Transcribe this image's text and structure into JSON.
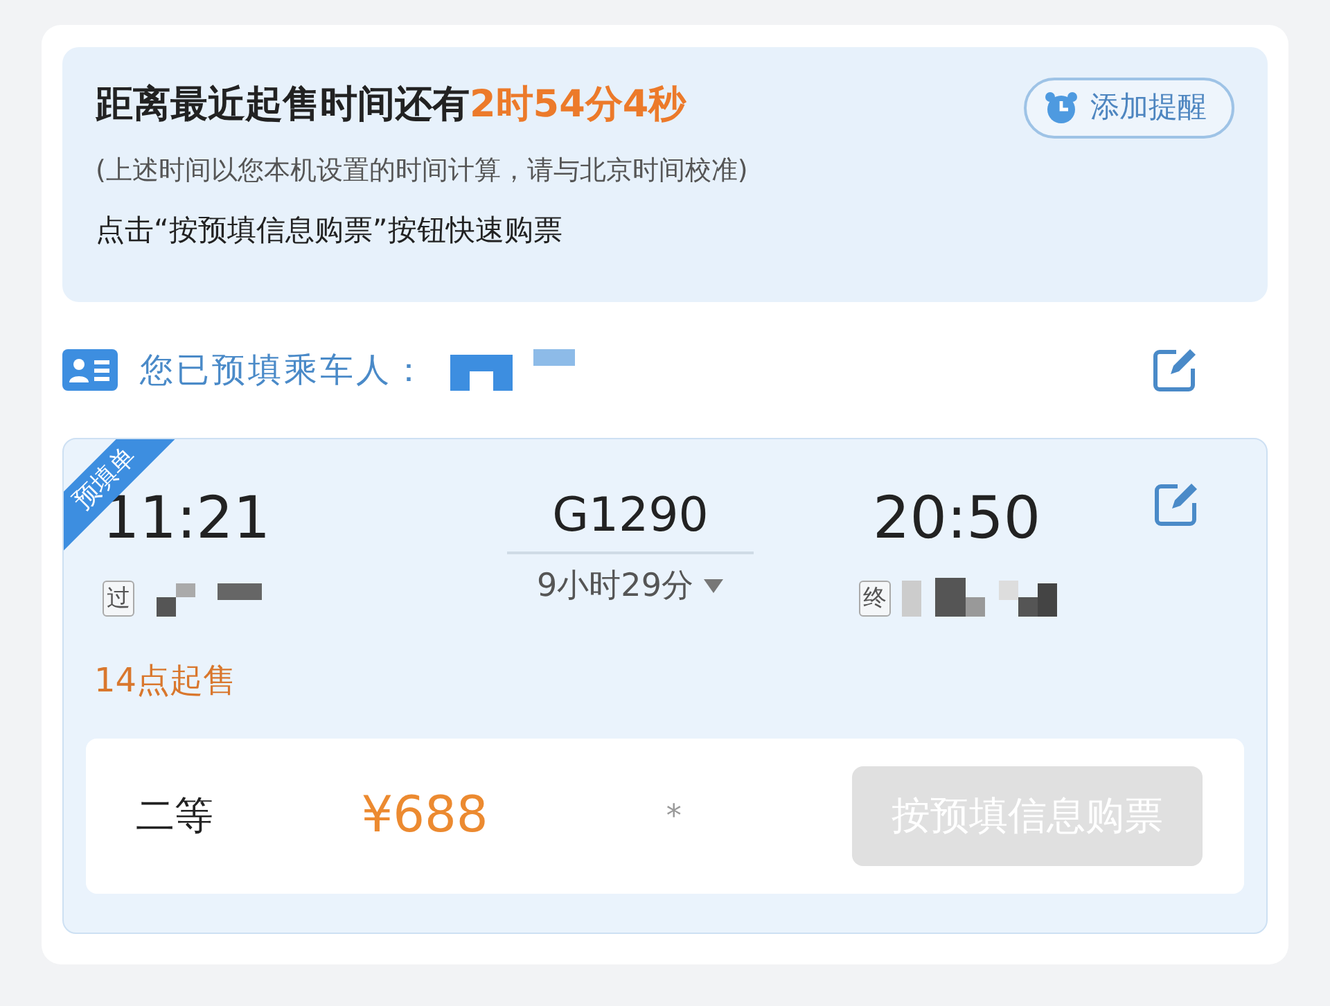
{
  "countdown": {
    "label": "距离最近起售时间还有",
    "time": "2时54分4秒",
    "note": "(上述时间以您本机设置的时间计算，请与北京时间校准)",
    "hint": "点击“按预填信息购票”按钮快速购票",
    "reminder_button": "添加提醒"
  },
  "passenger": {
    "label": "您已预填乘车人："
  },
  "order": {
    "ribbon": "预填单",
    "depart_time": "11:21",
    "train": "G1290",
    "duration": "9小时29分",
    "arrive_time": "20:50",
    "depart_tag": "过",
    "arrive_tag": "终",
    "sale_note": "14点起售",
    "seat_class": "二等",
    "price": "¥688",
    "availability": "*",
    "buy_button": {
      "label": "按预填信息购票",
      "disabled": true
    }
  }
}
